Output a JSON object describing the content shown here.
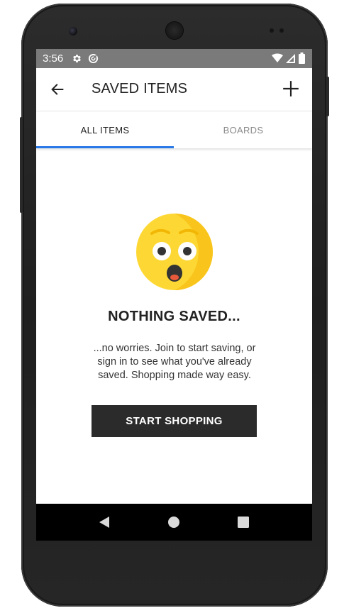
{
  "status_bar": {
    "time": "3:56",
    "icons": [
      "gear-icon",
      "sync-icon",
      "wifi-icon",
      "signal-icon",
      "battery-icon"
    ]
  },
  "app_bar": {
    "title": "SAVED ITEMS",
    "back_icon": "arrow-left-icon",
    "add_icon": "plus-icon"
  },
  "tabs": [
    {
      "label": "ALL ITEMS",
      "active": true
    },
    {
      "label": "BOARDS",
      "active": false
    }
  ],
  "empty_state": {
    "icon": "surprised-face-emoji",
    "title": "NOTHING SAVED...",
    "message": "...no worries. Join to start saving, or sign in to see what you've already saved. Shopping made way easy.",
    "button_label": "START SHOPPING"
  },
  "nav_bar": {
    "icons": [
      "back-triangle-icon",
      "home-circle-icon",
      "recents-square-icon"
    ]
  },
  "colors": {
    "tab_indicator": "#2979e8",
    "button_bg": "#2b2b2b",
    "status_bar_bg": "#7a7a7a",
    "emoji_yellow": "#fdd835"
  }
}
